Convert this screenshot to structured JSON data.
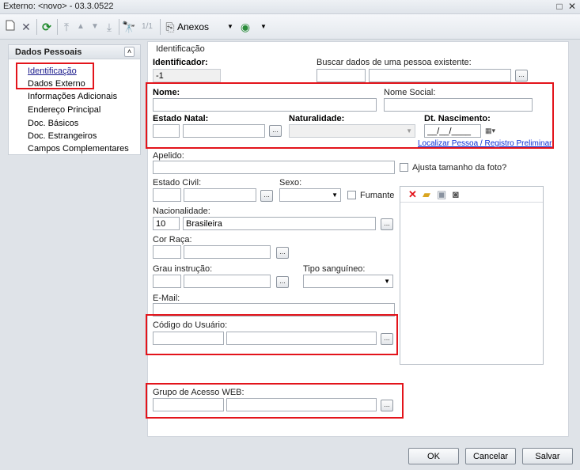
{
  "window": {
    "title": "Externo: <novo> - 03.3.0522",
    "restore_glyph": "□",
    "close_glyph": "✕"
  },
  "toolbar": {
    "new_icon": "new-document-icon",
    "delete_icon": "delete-icon",
    "refresh_icon": "refresh-icon",
    "page_counter": "1/1",
    "attachments_label": "Anexos"
  },
  "sidebar": {
    "header": "Dados Pessoais",
    "collapse_glyph": "˄",
    "items": [
      {
        "label": "Identificação",
        "active": true
      },
      {
        "label": "Dados Externo"
      },
      {
        "label": "Informações Adicionais"
      },
      {
        "label": "Endereço Principal"
      },
      {
        "label": "Doc. Básicos"
      },
      {
        "label": "Doc. Estrangeiros"
      },
      {
        "label": "Campos Complementares"
      }
    ]
  },
  "form": {
    "section_title": "Identificação",
    "identificador": {
      "label": "Identificador:",
      "value": "-1"
    },
    "buscar": {
      "label": "Buscar dados de uma pessoa existente:"
    },
    "nome": {
      "label": "Nome:"
    },
    "nome_social": {
      "label": "Nome Social:"
    },
    "estado_natal": {
      "label": "Estado Natal:"
    },
    "naturalidade": {
      "label": "Naturalidade:"
    },
    "dt_nascimento": {
      "label": "Dt. Nascimento:",
      "value": "__/__/____"
    },
    "localizar_link": "Localizar Pessoa / Registro Preliminar",
    "apelido": {
      "label": "Apelido:"
    },
    "ajusta_foto": {
      "label": "Ajusta tamanho da foto?"
    },
    "estado_civil": {
      "label": "Estado Civil:"
    },
    "sexo": {
      "label": "Sexo:"
    },
    "fumante": {
      "label": "Fumante"
    },
    "nacionalidade": {
      "label": "Nacionalidade:",
      "code": "10",
      "name": "Brasileira"
    },
    "cor_raca": {
      "label": "Cor Raça:"
    },
    "grau_instrucao": {
      "label": "Grau instrução:"
    },
    "tipo_sanguineo": {
      "label": "Tipo sanguíneo:"
    },
    "email": {
      "label": "E-Mail:"
    },
    "codigo_usuario": {
      "label": "Código do Usuário:"
    },
    "grupo_acesso": {
      "label": "Grupo de Acesso WEB:"
    },
    "ellipsis": "..."
  },
  "photo_toolbar": {
    "remove_icon": "remove-photo-icon",
    "open_icon": "open-folder-icon",
    "save_icon": "save-icon",
    "webcam_icon": "webcam-icon"
  },
  "buttons": {
    "ok": "OK",
    "cancelar": "Cancelar",
    "salvar": "Salvar"
  },
  "colors": {
    "highlight": "#e3141b",
    "link": "#0a2dd6"
  }
}
